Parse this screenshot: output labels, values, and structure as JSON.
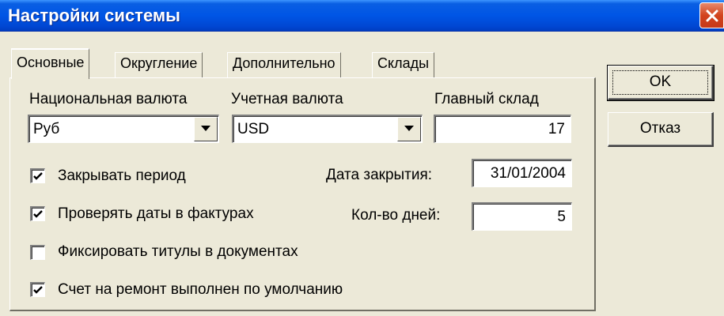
{
  "window": {
    "title": "Настройки системы",
    "close_icon": "close-icon"
  },
  "tabs": [
    {
      "label": "Основные",
      "active": true
    },
    {
      "label": "Округление",
      "active": false
    },
    {
      "label": "Дополнительно",
      "active": false
    },
    {
      "label": "Склады",
      "active": false
    }
  ],
  "main": {
    "national_currency": {
      "label": "Национальная валюта",
      "value": "Руб"
    },
    "accounting_currency": {
      "label": "Учетная валюта",
      "value": "USD"
    },
    "main_warehouse": {
      "label": "Главный склад",
      "value": "17"
    },
    "close_date": {
      "label": "Дата закрытия:",
      "value": "31/01/2004"
    },
    "days_count": {
      "label": "Кол-во дней:",
      "value": "5"
    },
    "checkboxes": [
      {
        "label": "Закрывать период",
        "checked": true
      },
      {
        "label": "Проверять даты в фактурах",
        "checked": true
      },
      {
        "label": "Фиксировать титулы в документах",
        "checked": false
      },
      {
        "label": "Счет на ремонт выполнен по умолчанию",
        "checked": true
      }
    ]
  },
  "buttons": {
    "ok_label": "OK",
    "cancel_label": "Отказ"
  },
  "colors": {
    "title_bar": "#0055e5",
    "close_button": "#d2431d",
    "dialog_bg": "#ece9d8"
  }
}
